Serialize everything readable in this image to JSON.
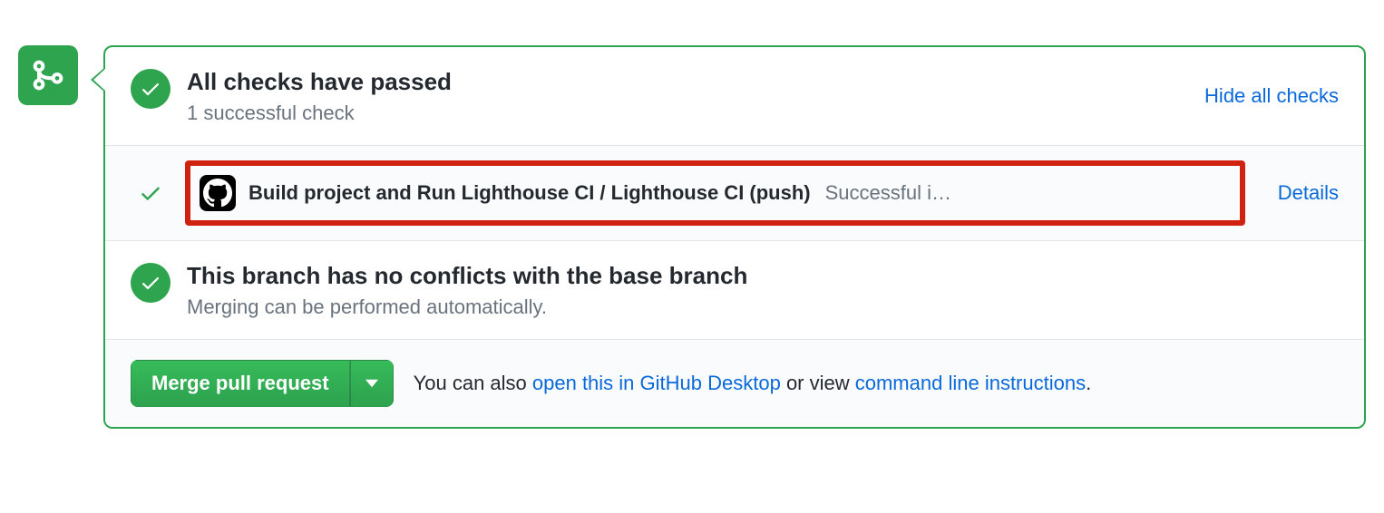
{
  "checks_summary": {
    "title": "All checks have passed",
    "subtitle": "1 successful check",
    "toggle_label": "Hide all checks"
  },
  "checks": [
    {
      "name": "Build project and Run Lighthouse CI / Lighthouse CI (push)",
      "result": "Successful i…",
      "details_label": "Details"
    }
  ],
  "conflicts": {
    "title": "This branch has no conflicts with the base branch",
    "subtitle": "Merging can be performed automatically."
  },
  "merge": {
    "button_label": "Merge pull request",
    "hint_prefix": "You can also ",
    "desktop_link": "open this in GitHub Desktop",
    "hint_middle": " or view ",
    "cli_link": "command line instructions",
    "hint_suffix": "."
  }
}
